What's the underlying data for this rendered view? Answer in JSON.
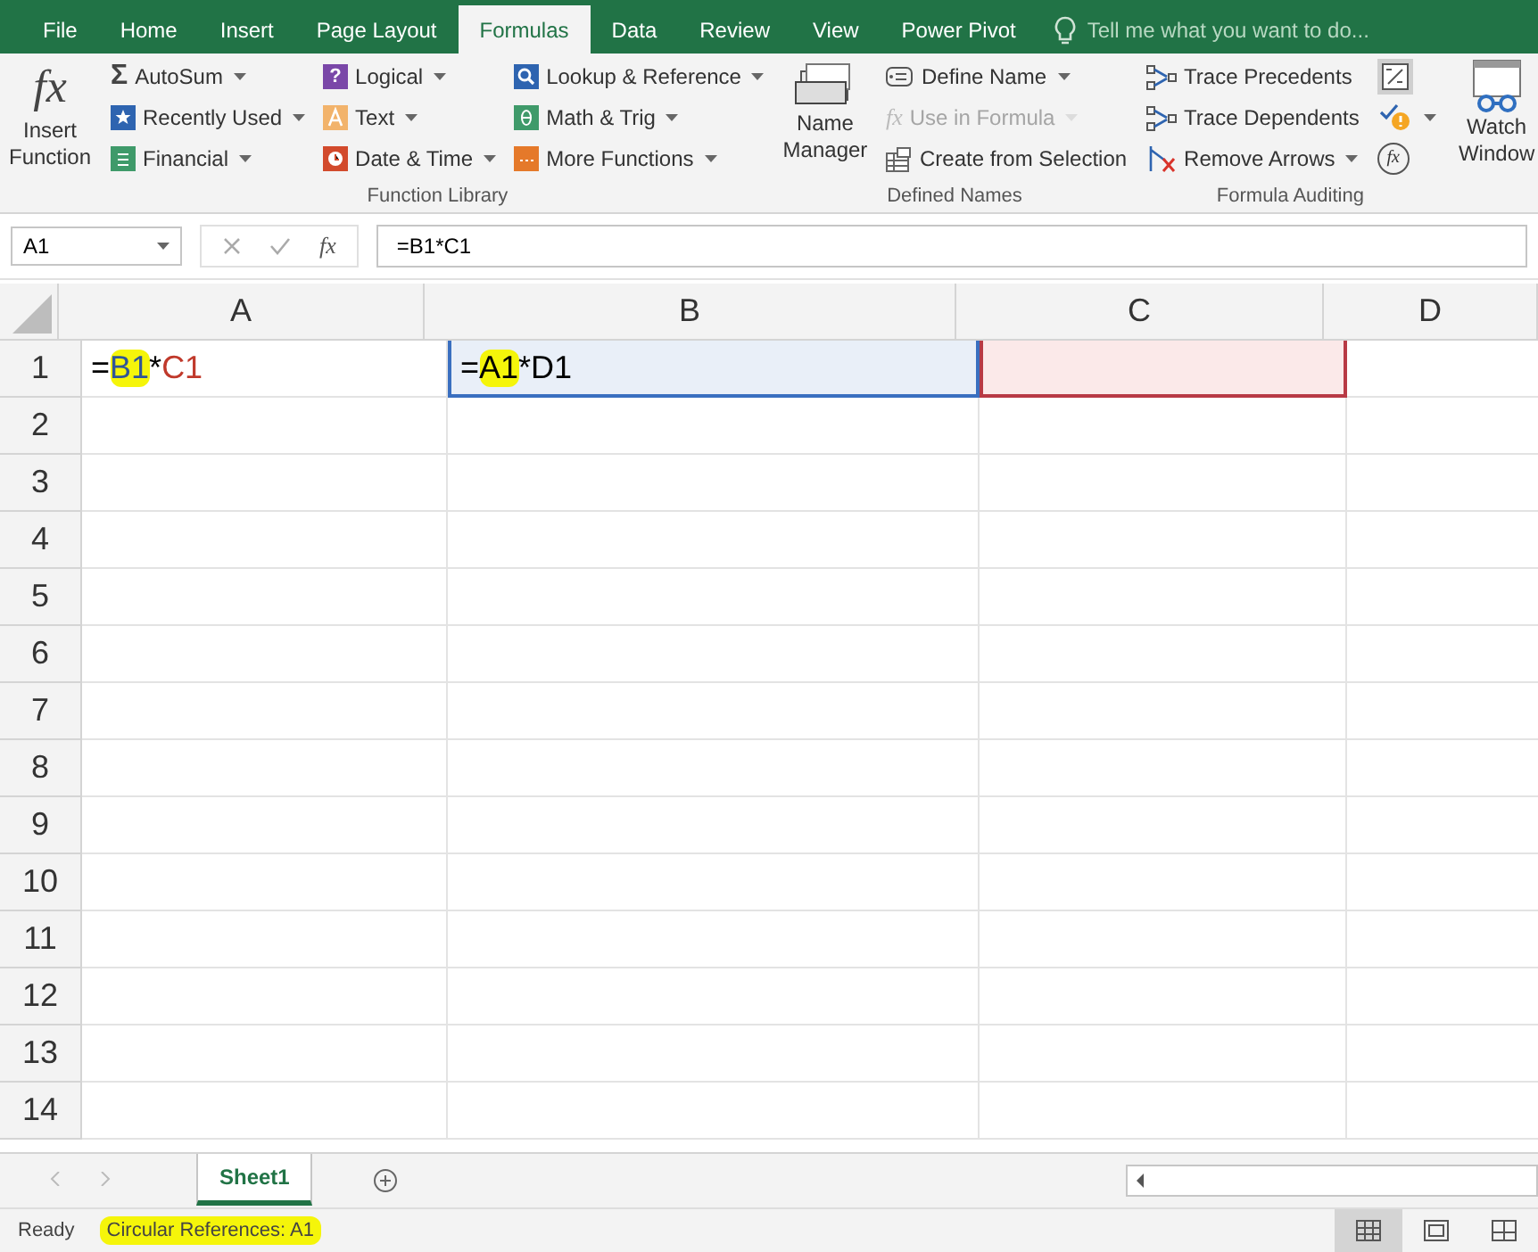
{
  "menu_tabs": [
    {
      "label": "File",
      "selected": false
    },
    {
      "label": "Home",
      "selected": false
    },
    {
      "label": "Insert",
      "selected": false
    },
    {
      "label": "Page Layout",
      "selected": false
    },
    {
      "label": "Formulas",
      "selected": true
    },
    {
      "label": "Data",
      "selected": false
    },
    {
      "label": "Review",
      "selected": false
    },
    {
      "label": "View",
      "selected": false
    },
    {
      "label": "Power Pivot",
      "selected": false
    }
  ],
  "tell_me": {
    "placeholder": "Tell me what you want to do..."
  },
  "ribbon_groups": [
    {
      "big_buttons": [
        {
          "label": "Insert Function",
          "kind": "fx",
          "glyph": "fx"
        }
      ]
    },
    {
      "title": "Function Library",
      "columns": [
        [
          {
            "label": "AutoSum",
            "kind": "sigma",
            "glyph": "Σ",
            "dropdown": true,
            "disabled": false
          },
          {
            "label": "Recently Used",
            "kind": "star",
            "dropdown": true,
            "disabled": false
          },
          {
            "label": "Financial",
            "kind": "book-green",
            "dropdown": true,
            "disabled": false
          }
        ],
        [
          {
            "label": "Logical",
            "kind": "question",
            "glyph": "?",
            "dropdown": true,
            "disabled": false
          },
          {
            "label": "Text",
            "kind": "letter",
            "dropdown": true,
            "disabled": false
          },
          {
            "label": "Date & Time",
            "kind": "clock",
            "dropdown": true,
            "disabled": false
          }
        ],
        [
          {
            "label": "Lookup & Reference",
            "kind": "magnifier",
            "dropdown": true,
            "disabled": false
          },
          {
            "label": "Math & Trig",
            "kind": "theta",
            "dropdown": true,
            "disabled": false
          },
          {
            "label": "More Functions",
            "kind": "dots",
            "dropdown": true,
            "disabled": false
          }
        ]
      ]
    },
    {
      "title": "Defined Names",
      "big_buttons": [
        {
          "label": "Name Manager",
          "kind": "cards"
        }
      ],
      "columns": [
        [
          {
            "label": "Define Name",
            "kind": "tag",
            "dropdown": true,
            "disabled": false
          },
          {
            "label": "Use in Formula",
            "kind": "fx-small",
            "glyph": "fx",
            "dropdown": true,
            "disabled": true
          },
          {
            "label": "Create from Selection",
            "kind": "grid",
            "dropdown": false,
            "disabled": false
          }
        ]
      ]
    },
    {
      "title": "Formula Auditing",
      "columns": [
        [
          {
            "label": "Trace Precedents",
            "kind": "trace",
            "dropdown": false,
            "disabled": false
          },
          {
            "label": "Trace Dependents",
            "kind": "trace",
            "dropdown": false,
            "disabled": false
          },
          {
            "label": "Remove Arrows",
            "kind": "remove",
            "dropdown": true,
            "disabled": false
          }
        ],
        [
          {
            "kind": "show-formulas",
            "dropdown": false,
            "disabled": false
          },
          {
            "kind": "error-check",
            "dropdown": true,
            "disabled": false
          },
          {
            "kind": "evaluate",
            "glyph": "fx",
            "dropdown": false,
            "disabled": false
          }
        ]
      ]
    },
    {
      "big_buttons": [
        {
          "label": "Watch Window",
          "kind": "glasses"
        }
      ]
    }
  ],
  "name_box": {
    "value": "A1"
  },
  "formula_bar": {
    "glyph": "fx",
    "value": "=B1*C1"
  },
  "columns": [
    "A",
    "B",
    "C",
    "D"
  ],
  "rows": [
    "1",
    "2",
    "3",
    "4",
    "5",
    "6",
    "7",
    "8",
    "9",
    "10",
    "11",
    "12",
    "13",
    "14"
  ],
  "cells": [
    {
      "tokens": [
        {
          "text": "=",
          "kind": "plain",
          "highlighted": false
        },
        {
          "text": "B1",
          "kind": "blue",
          "highlighted": true
        },
        {
          "text": "*",
          "kind": "plain",
          "highlighted": false
        },
        {
          "text": "C1",
          "kind": "red",
          "highlighted": false
        }
      ]
    },
    {
      "tokens": [
        {
          "text": "=",
          "kind": "plain",
          "highlighted": false
        },
        {
          "text": "A1",
          "kind": "plain",
          "highlighted": true
        },
        {
          "text": "*D1",
          "kind": "plain",
          "highlighted": false
        }
      ]
    }
  ],
  "sheet_tabs": [
    {
      "label": "Sheet1",
      "selected": true
    }
  ],
  "status_bar": {
    "mode": "Ready",
    "message": "Circular References: A1",
    "message_highlighted": true
  },
  "view_buttons": [
    {
      "kind": "normal",
      "selected": true
    },
    {
      "kind": "page-layout",
      "selected": false
    },
    {
      "kind": "page-break",
      "selected": false
    }
  ]
}
